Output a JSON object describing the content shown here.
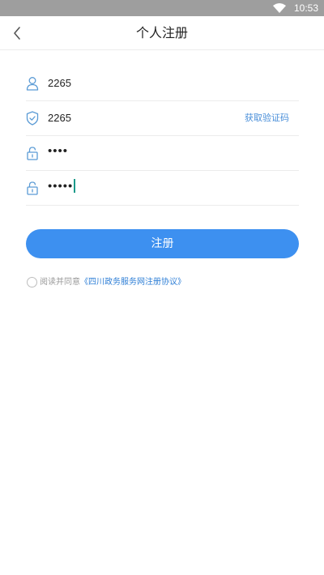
{
  "status_bar": {
    "time": "10:53",
    "wifi_icon": "wifi-icon"
  },
  "header": {
    "title": "个人注册",
    "back_icon": "chevron-left-icon"
  },
  "form": {
    "username": {
      "icon": "user-icon",
      "value": "2265"
    },
    "verification_code": {
      "icon": "shield-check-icon",
      "value": "2265",
      "get_code_label": "获取验证码"
    },
    "password": {
      "icon": "lock-icon",
      "value": "••••"
    },
    "confirm_password": {
      "icon": "lock-icon",
      "value": "•••••"
    }
  },
  "submit_label": "注册",
  "agreement": {
    "prefix": "阅读并同意",
    "link_text": "《四川政务服务网注册协议》",
    "checked": false
  },
  "colors": {
    "primary": "#3d90f0",
    "link": "#2f7fd6",
    "status_bar": "#9e9e9e",
    "icon": "#5b9bd5"
  }
}
